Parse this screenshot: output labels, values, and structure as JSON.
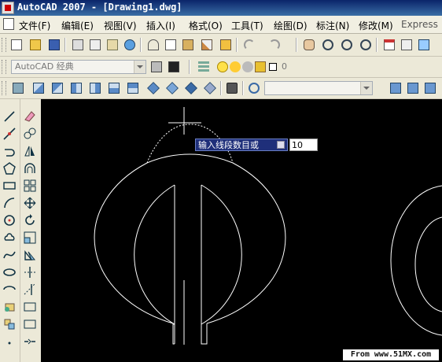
{
  "window": {
    "title": "AutoCAD 2007 - [Drawing1.dwg]"
  },
  "menu": [
    {
      "id": "file",
      "label": "文件(F)"
    },
    {
      "id": "edit",
      "label": "编辑(E)"
    },
    {
      "id": "view",
      "label": "视图(V)"
    },
    {
      "id": "insert",
      "label": "插入(I)"
    },
    {
      "id": "format",
      "label": "格式(O)"
    },
    {
      "id": "tools",
      "label": "工具(T)"
    },
    {
      "id": "draw",
      "label": "绘图(D)"
    },
    {
      "id": "dimension",
      "label": "标注(N)"
    },
    {
      "id": "modify",
      "label": "修改(M)"
    },
    {
      "id": "express",
      "label": "Express"
    }
  ],
  "workspace": {
    "value": "AutoCAD 经典"
  },
  "layer": {
    "value": "0"
  },
  "command": {
    "prompt": "输入线段数目或",
    "input_value": "10"
  },
  "watermark": "From www.51MX.com",
  "colors": {
    "canvas_bg": "#000000",
    "entity": "#ffffff",
    "title_bar": "#0a246a",
    "prompt_bg": "#1f2f7a"
  }
}
